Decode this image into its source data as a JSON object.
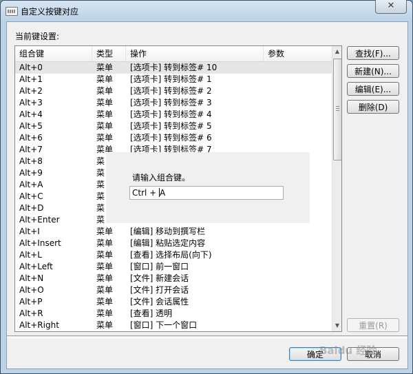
{
  "window": {
    "title": "自定义按键对应",
    "close_glyph": "✕"
  },
  "dialog": {
    "current_settings_label": "当前键设置:",
    "columns": [
      "组合键",
      "类型",
      "操作",
      "参数"
    ],
    "rows": [
      {
        "key": "Alt+0",
        "type": "菜单",
        "action": "[选项卡] 转到标签# 10",
        "param": ""
      },
      {
        "key": "Alt+1",
        "type": "菜单",
        "action": "[选项卡] 转到标签# 1",
        "param": ""
      },
      {
        "key": "Alt+2",
        "type": "菜单",
        "action": "[选项卡] 转到标签# 2",
        "param": ""
      },
      {
        "key": "Alt+3",
        "type": "菜单",
        "action": "[选项卡] 转到标签# 3",
        "param": ""
      },
      {
        "key": "Alt+4",
        "type": "菜单",
        "action": "[选项卡] 转到标签# 4",
        "param": ""
      },
      {
        "key": "Alt+5",
        "type": "菜单",
        "action": "[选项卡] 转到标签# 5",
        "param": ""
      },
      {
        "key": "Alt+6",
        "type": "菜单",
        "action": "[选项卡] 转到标签# 6",
        "param": ""
      },
      {
        "key": "Alt+7",
        "type": "菜单",
        "action": "[选项卡] 转到标签# 7",
        "param": ""
      },
      {
        "key": "Alt+8",
        "type": "菜",
        "action": "",
        "param": ""
      },
      {
        "key": "Alt+9",
        "type": "菜",
        "action": "",
        "param": ""
      },
      {
        "key": "Alt+A",
        "type": "菜",
        "action": "",
        "param": ""
      },
      {
        "key": "Alt+C",
        "type": "菜",
        "action": "",
        "param": ""
      },
      {
        "key": "Alt+D",
        "type": "菜",
        "action": "",
        "param": ""
      },
      {
        "key": "Alt+Enter",
        "type": "菜",
        "action": "",
        "param": ""
      },
      {
        "key": "Alt+I",
        "type": "菜单",
        "action": "[编辑] 移动到撰写栏",
        "param": ""
      },
      {
        "key": "Alt+Insert",
        "type": "菜单",
        "action": "[编辑] 粘贴选定内容",
        "param": ""
      },
      {
        "key": "Alt+L",
        "type": "菜单",
        "action": "[查看] 选择布局(向下)",
        "param": ""
      },
      {
        "key": "Alt+Left",
        "type": "菜单",
        "action": "[窗口] 前一窗口",
        "param": ""
      },
      {
        "key": "Alt+N",
        "type": "菜单",
        "action": "[文件] 新建会话",
        "param": ""
      },
      {
        "key": "Alt+O",
        "type": "菜单",
        "action": "[文件] 打开会话",
        "param": ""
      },
      {
        "key": "Alt+P",
        "type": "菜单",
        "action": "[文件] 会话属性",
        "param": ""
      },
      {
        "key": "Alt+R",
        "type": "菜单",
        "action": "[查看] 透明",
        "param": ""
      },
      {
        "key": "Alt+Right",
        "type": "菜单",
        "action": "[窗口] 下一个窗口",
        "param": ""
      }
    ],
    "selected_row_index": 0,
    "buttons": {
      "find": "查找(F)...",
      "new": "新建(N)...",
      "edit": "编辑(E)...",
      "delete": "删除(D)",
      "reset": "重置(R)",
      "ok": "确定",
      "cancel": "取消"
    },
    "scroll_up_glyph": "▲",
    "scroll_down_glyph": "▼"
  },
  "key_capture_popup": {
    "prompt": "请输入组合键。",
    "input_value": "Ctrl + ",
    "input_after_caret": "A"
  },
  "watermark": "Baidu 经验"
}
